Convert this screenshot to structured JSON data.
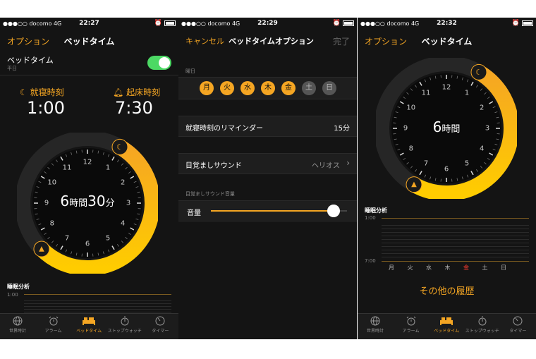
{
  "screen1": {
    "status": {
      "carrier": "●●●○○ docomo  4G",
      "time": "22:27"
    },
    "nav": {
      "left": "オプション",
      "title": "ベッドタイム"
    },
    "bedtime_row": {
      "label": "ベッドタイム",
      "sub": "平日"
    },
    "sleep": {
      "label": "就寝時刻",
      "time": "1:00"
    },
    "wake": {
      "label": "起床時刻",
      "time": "7:30"
    },
    "duration": {
      "hours": "6",
      "h_unit": "時間",
      "minutes": "30",
      "m_unit": "分"
    },
    "analysis": {
      "label": "睡眠分析",
      "tick": "1:00"
    }
  },
  "screen2": {
    "status": {
      "carrier": "●●●○○ docomo  4G",
      "time": "22:29"
    },
    "nav": {
      "left": "キャンセル",
      "title": "ベッドタイムオプション",
      "right": "完了"
    },
    "days_label": "曜日",
    "days": [
      "月",
      "火",
      "水",
      "木",
      "金",
      "土",
      "日"
    ],
    "reminder": {
      "label": "就寝時刻のリマインダー",
      "value": "15分"
    },
    "sound": {
      "label": "目覚ましサウンド",
      "value": "ヘリオス"
    },
    "volume_header": "目覚ましサウンド音量",
    "volume": {
      "label": "音量",
      "level": 0.9
    }
  },
  "screen3": {
    "status": {
      "carrier": "●●●○○ docomo  4G",
      "time": "22:32"
    },
    "nav": {
      "left": "オプション",
      "title": "ベッドタイム"
    },
    "duration": {
      "hours": "6",
      "h_unit": "時間"
    },
    "analysis": {
      "label": "睡眠分析",
      "tick_top": "1:00",
      "tick_bottom": "7:00",
      "days": [
        "月",
        "火",
        "水",
        "木",
        "金",
        "土",
        "日"
      ]
    },
    "history": "その他の履歴"
  },
  "clock_numbers": [
    "12",
    "1",
    "2",
    "3",
    "4",
    "5",
    "6",
    "7",
    "8",
    "9",
    "10",
    "11"
  ],
  "tabs": [
    {
      "label": "世界時計",
      "icon": "globe-icon"
    },
    {
      "label": "アラーム",
      "icon": "alarm-clock-icon"
    },
    {
      "label": "ベッドタイム",
      "icon": "bed-icon"
    },
    {
      "label": "ストップウォッチ",
      "icon": "stopwatch-icon"
    },
    {
      "label": "タイマー",
      "icon": "timer-icon"
    }
  ],
  "colors": {
    "accent": "#f5a623",
    "background": "#141414",
    "toggle_on": "#4cd964",
    "sunday": "#ff3b30"
  }
}
